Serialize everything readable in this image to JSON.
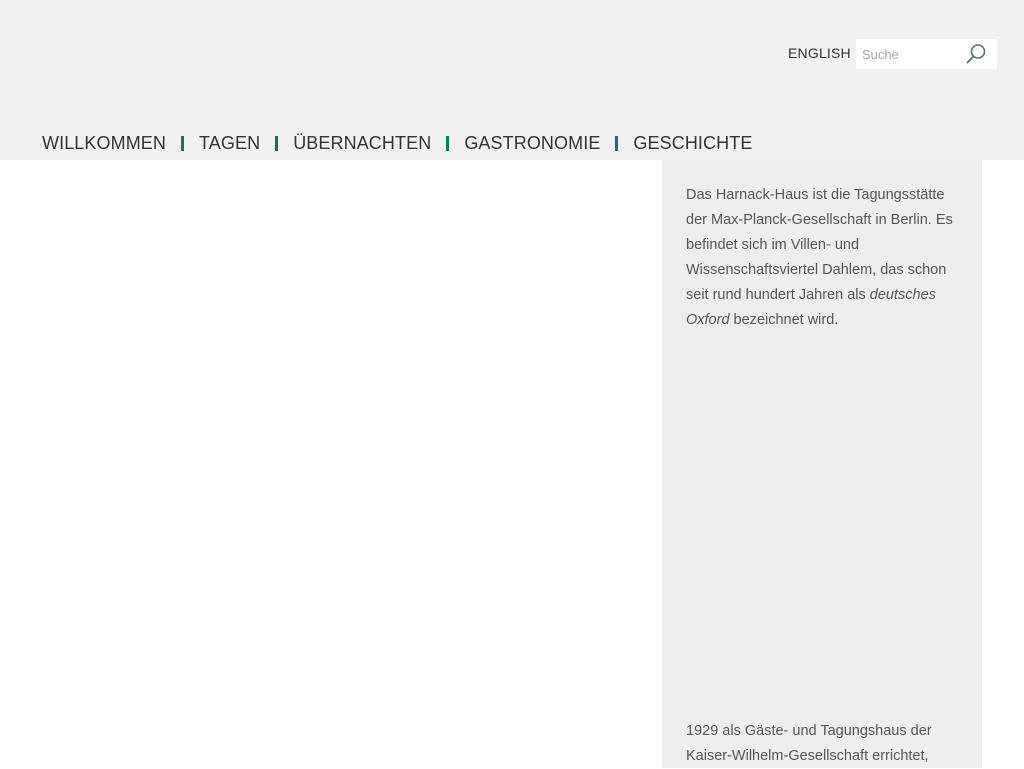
{
  "header": {
    "language_link": "ENGLISH",
    "search": {
      "placeholder": "Suche",
      "value": ""
    }
  },
  "nav": {
    "items": [
      {
        "label": "WILLKOMMEN"
      },
      {
        "label": "TAGEN"
      },
      {
        "label": "ÜBERNACHTEN"
      },
      {
        "label": "GASTRONOMIE"
      },
      {
        "label": "GESCHICHTE"
      }
    ]
  },
  "sidebar": {
    "intro": {
      "before": "Das Harnack-Haus ist die Tagungsstätte der Max-Planck-Gesellschaft in Berlin. Es befindet sich im Villen- und Wissenschaftsviertel Dahlem, das schon seit rund hundert Jahren als ",
      "emphasis": "deutsches Oxford",
      "after": " bezeichnet wird."
    },
    "history": "1929 als Gäste- und Tagungshaus der Kaiser-Wilhelm-Gesellschaft errichtet,"
  },
  "colors": {
    "header_bg": "#f1f1f1",
    "sidebar_bg": "#eeeeee",
    "accent": "#0b7566",
    "text": "#333333"
  },
  "icons": {
    "search": "search-icon"
  }
}
